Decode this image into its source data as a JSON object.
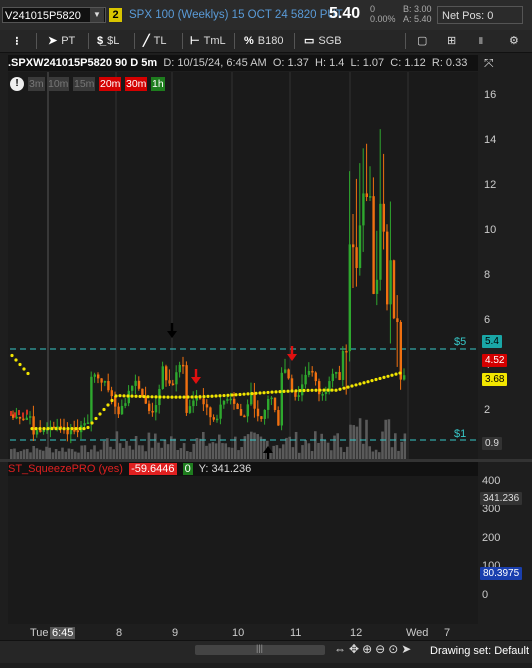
{
  "header": {
    "symbol": "V241015P5820",
    "link_badge": "2",
    "description": "SPX 100 (Weeklys) 15 OCT 24 5820 PUT",
    "last": "5.40",
    "change": "0",
    "change_pct": "0.00%",
    "bid": "B: 3.00",
    "ask": "A: 5.40",
    "net_pos": "Net Pos: 0"
  },
  "toolbar": {
    "pt": "PT",
    "dollar_l": "$L",
    "tl": "TL",
    "tml": "TmL",
    "b180": "B180",
    "sgb": "SGB"
  },
  "chart_info": {
    "symbol": ".SPXW241015P5820 90 D 5m",
    "date": "D: 10/15/24, 6:45 AM",
    "open": "O: 1.37",
    "high": "H: 1.4",
    "low": "L: 1.07",
    "close": "C: 1.12",
    "range": "R: 0.33"
  },
  "timeframes": [
    {
      "label": "3m",
      "active": false,
      "color": "#3a3a3a"
    },
    {
      "label": "10m",
      "active": false,
      "color": "#3a3a3a"
    },
    {
      "label": "15m",
      "active": false,
      "color": "#3a3a3a"
    },
    {
      "label": "20m",
      "active": true,
      "color": "#d40000"
    },
    {
      "label": "30m",
      "active": true,
      "color": "#d40000"
    },
    {
      "label": "1h",
      "active": true,
      "color": "#1e7d1e"
    }
  ],
  "price_axis": {
    "ticks": [
      "16",
      "14",
      "12",
      "10",
      "8",
      "6",
      "4",
      "2"
    ],
    "tags": [
      {
        "text": "5.4",
        "bg": "#1aa7a7",
        "fg": "#000"
      },
      {
        "text": "4.52",
        "bg": "#d40000",
        "fg": "#fff"
      },
      {
        "text": "3.68",
        "bg": "#f2e600",
        "fg": "#000"
      },
      {
        "text": "0.9",
        "bg": "#333",
        "fg": "#ddd"
      }
    ],
    "level_labels": [
      "$5",
      "$1"
    ]
  },
  "indicator": {
    "name": "ST_SqueezePRO (yes)",
    "value": "-59.6446",
    "zero": "0",
    "y": "Y: 341.236",
    "ticks": [
      "400",
      "300",
      "200",
      "100",
      "0"
    ],
    "tags": [
      {
        "text": "341.236",
        "bg": "#333",
        "fg": "#ddd"
      },
      {
        "text": "80.3975",
        "bg": "#1a3fae",
        "fg": "#fff"
      }
    ]
  },
  "time_axis": {
    "labels": [
      "Tue",
      "6:45",
      "8",
      "9",
      "10",
      "11",
      "12",
      "Wed",
      "7"
    ]
  },
  "footer": {
    "drawing_set": "Drawing set: Default"
  },
  "colors": {
    "up": "#2ea82e",
    "down": "#f07010",
    "cyan": "#37c8c8",
    "ma": "#f2e600",
    "hist_cyan": "#22d6e8",
    "hist_blue": "#1638d6",
    "hist_red": "#e01010",
    "hist_yellow": "#e8d600"
  }
}
